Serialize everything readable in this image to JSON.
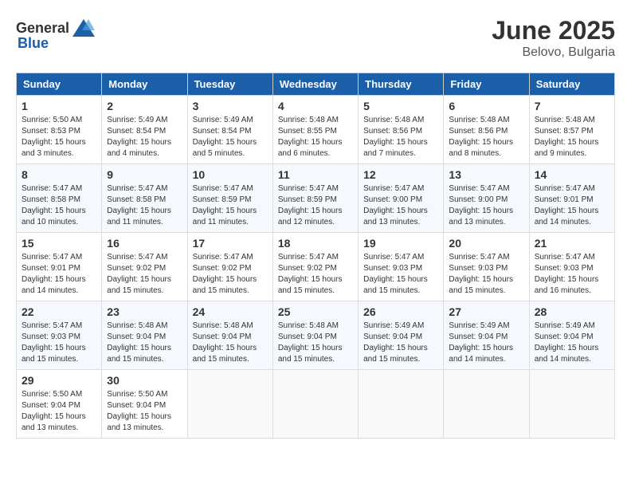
{
  "header": {
    "logo_general": "General",
    "logo_blue": "Blue",
    "month": "June 2025",
    "location": "Belovo, Bulgaria"
  },
  "weekdays": [
    "Sunday",
    "Monday",
    "Tuesday",
    "Wednesday",
    "Thursday",
    "Friday",
    "Saturday"
  ],
  "weeks": [
    [
      {
        "day": "1",
        "sunrise": "5:50 AM",
        "sunset": "8:53 PM",
        "daylight": "15 hours and 3 minutes."
      },
      {
        "day": "2",
        "sunrise": "5:49 AM",
        "sunset": "8:54 PM",
        "daylight": "15 hours and 4 minutes."
      },
      {
        "day": "3",
        "sunrise": "5:49 AM",
        "sunset": "8:54 PM",
        "daylight": "15 hours and 5 minutes."
      },
      {
        "day": "4",
        "sunrise": "5:48 AM",
        "sunset": "8:55 PM",
        "daylight": "15 hours and 6 minutes."
      },
      {
        "day": "5",
        "sunrise": "5:48 AM",
        "sunset": "8:56 PM",
        "daylight": "15 hours and 7 minutes."
      },
      {
        "day": "6",
        "sunrise": "5:48 AM",
        "sunset": "8:56 PM",
        "daylight": "15 hours and 8 minutes."
      },
      {
        "day": "7",
        "sunrise": "5:48 AM",
        "sunset": "8:57 PM",
        "daylight": "15 hours and 9 minutes."
      }
    ],
    [
      {
        "day": "8",
        "sunrise": "5:47 AM",
        "sunset": "8:58 PM",
        "daylight": "15 hours and 10 minutes."
      },
      {
        "day": "9",
        "sunrise": "5:47 AM",
        "sunset": "8:58 PM",
        "daylight": "15 hours and 11 minutes."
      },
      {
        "day": "10",
        "sunrise": "5:47 AM",
        "sunset": "8:59 PM",
        "daylight": "15 hours and 11 minutes."
      },
      {
        "day": "11",
        "sunrise": "5:47 AM",
        "sunset": "8:59 PM",
        "daylight": "15 hours and 12 minutes."
      },
      {
        "day": "12",
        "sunrise": "5:47 AM",
        "sunset": "9:00 PM",
        "daylight": "15 hours and 13 minutes."
      },
      {
        "day": "13",
        "sunrise": "5:47 AM",
        "sunset": "9:00 PM",
        "daylight": "15 hours and 13 minutes."
      },
      {
        "day": "14",
        "sunrise": "5:47 AM",
        "sunset": "9:01 PM",
        "daylight": "15 hours and 14 minutes."
      }
    ],
    [
      {
        "day": "15",
        "sunrise": "5:47 AM",
        "sunset": "9:01 PM",
        "daylight": "15 hours and 14 minutes."
      },
      {
        "day": "16",
        "sunrise": "5:47 AM",
        "sunset": "9:02 PM",
        "daylight": "15 hours and 15 minutes."
      },
      {
        "day": "17",
        "sunrise": "5:47 AM",
        "sunset": "9:02 PM",
        "daylight": "15 hours and 15 minutes."
      },
      {
        "day": "18",
        "sunrise": "5:47 AM",
        "sunset": "9:02 PM",
        "daylight": "15 hours and 15 minutes."
      },
      {
        "day": "19",
        "sunrise": "5:47 AM",
        "sunset": "9:03 PM",
        "daylight": "15 hours and 15 minutes."
      },
      {
        "day": "20",
        "sunrise": "5:47 AM",
        "sunset": "9:03 PM",
        "daylight": "15 hours and 15 minutes."
      },
      {
        "day": "21",
        "sunrise": "5:47 AM",
        "sunset": "9:03 PM",
        "daylight": "15 hours and 16 minutes."
      }
    ],
    [
      {
        "day": "22",
        "sunrise": "5:47 AM",
        "sunset": "9:03 PM",
        "daylight": "15 hours and 15 minutes."
      },
      {
        "day": "23",
        "sunrise": "5:48 AM",
        "sunset": "9:04 PM",
        "daylight": "15 hours and 15 minutes."
      },
      {
        "day": "24",
        "sunrise": "5:48 AM",
        "sunset": "9:04 PM",
        "daylight": "15 hours and 15 minutes."
      },
      {
        "day": "25",
        "sunrise": "5:48 AM",
        "sunset": "9:04 PM",
        "daylight": "15 hours and 15 minutes."
      },
      {
        "day": "26",
        "sunrise": "5:49 AM",
        "sunset": "9:04 PM",
        "daylight": "15 hours and 15 minutes."
      },
      {
        "day": "27",
        "sunrise": "5:49 AM",
        "sunset": "9:04 PM",
        "daylight": "15 hours and 14 minutes."
      },
      {
        "day": "28",
        "sunrise": "5:49 AM",
        "sunset": "9:04 PM",
        "daylight": "15 hours and 14 minutes."
      }
    ],
    [
      {
        "day": "29",
        "sunrise": "5:50 AM",
        "sunset": "9:04 PM",
        "daylight": "15 hours and 13 minutes."
      },
      {
        "day": "30",
        "sunrise": "5:50 AM",
        "sunset": "9:04 PM",
        "daylight": "15 hours and 13 minutes."
      },
      null,
      null,
      null,
      null,
      null
    ]
  ],
  "labels": {
    "sunrise": "Sunrise:",
    "sunset": "Sunset:",
    "daylight": "Daylight:"
  }
}
